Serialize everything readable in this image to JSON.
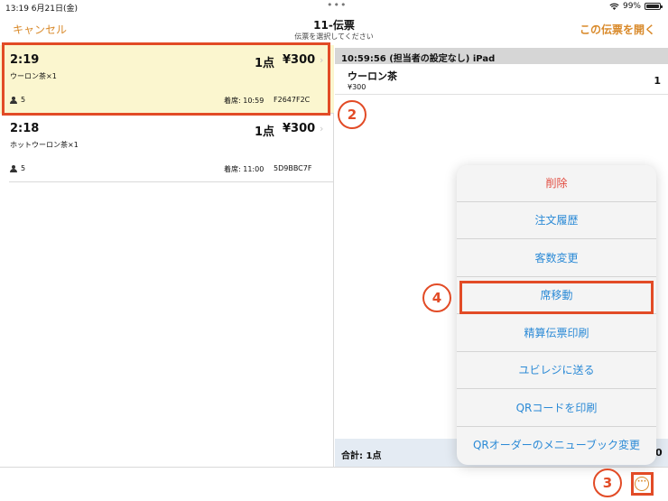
{
  "status_bar": {
    "time": "13:19  6月21日(金)",
    "dots": "•••",
    "battery": "99%"
  },
  "nav": {
    "cancel_label": "キャンセル",
    "title": "11-伝票",
    "subtitle": "伝票を選択してください",
    "open_label": "この伝票を開く"
  },
  "slips": [
    {
      "number": "2:19",
      "items": "ウーロン茶×1",
      "qty": "1点",
      "price": "¥300",
      "chevron": "›",
      "guests": "5",
      "seated": "着席: 10:59",
      "code": "F2647F2C",
      "selected": true
    },
    {
      "number": "2:18",
      "items": "ホットウーロン茶×1",
      "qty": "1点",
      "price": "¥300",
      "chevron": "›",
      "guests": "5",
      "seated": "着席: 11:00",
      "code": "5D9BBC7F",
      "selected": false
    }
  ],
  "detail": {
    "header": "10:59:56 (担当者の設定なし) iPad",
    "item_name": "ウーロン茶",
    "item_price": "¥300",
    "item_qty": "1",
    "total_label": "合計: 1点",
    "total_edge": "0"
  },
  "menu": {
    "items": [
      "削除",
      "注文履歴",
      "客数変更",
      "席移動",
      "精算伝票印刷",
      "ユビレジに送る",
      "QRコードを印刷",
      "QRオーダーのメニューブック変更"
    ]
  },
  "more_button": "···",
  "annotations": {
    "step2": "2",
    "step3": "3",
    "step4": "4"
  },
  "colors": {
    "accent": "#d98a2b",
    "link": "#2b8ad6",
    "danger": "#e24b3f",
    "annotation": "#e24b26",
    "selected_bg": "#fbf6cf"
  }
}
